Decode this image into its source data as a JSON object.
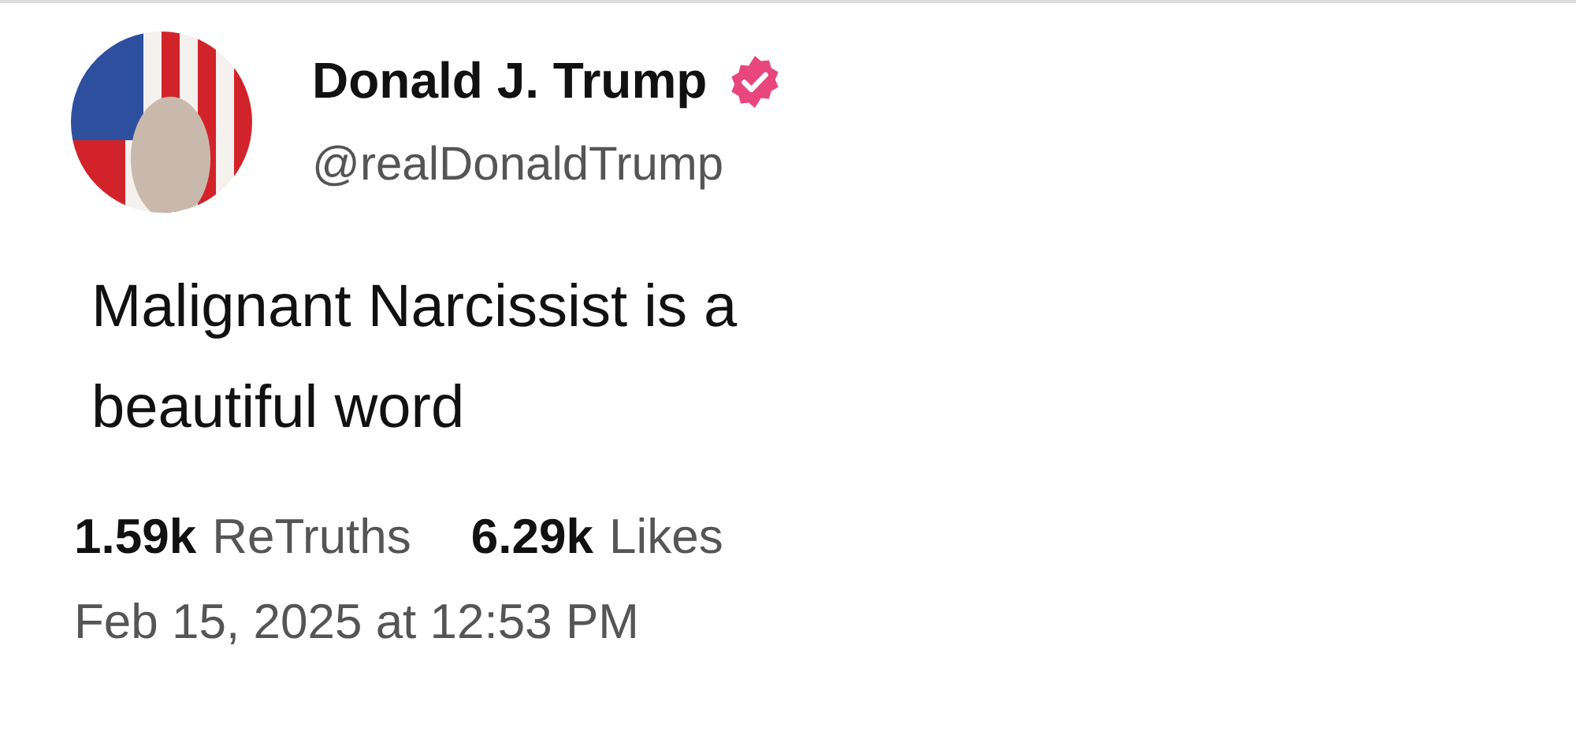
{
  "author": {
    "name": "Donald J. Trump",
    "verified": true,
    "handle": "@realDonaldTrump"
  },
  "post": {
    "text": "Malignant Narcissist is a beautiful word"
  },
  "stats": [
    {
      "count": "1.59k",
      "label": "ReTruths"
    },
    {
      "count": "6.29k",
      "label": "Likes"
    }
  ],
  "timestamp": "Feb 15, 2025 at 12:53 PM"
}
